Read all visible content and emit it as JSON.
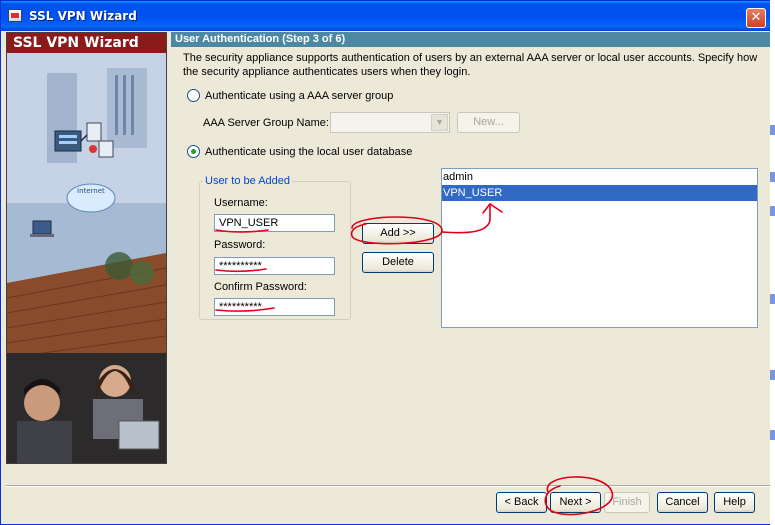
{
  "window": {
    "title": "SSL VPN Wizard",
    "close_glyph": "✕",
    "icon": "app-icon"
  },
  "left_panel": {
    "header": "SSL VPN Wizard",
    "globe_text": "Internet"
  },
  "step": {
    "header": "User Authentication  (Step 3 of 6)",
    "description": "The security appliance supports authentication of users by an external AAA server or local user accounts. Specify how the security appliance authenticates users when they login."
  },
  "auth": {
    "aaa_radio_label": "Authenticate using a AAA server group",
    "aaa_group_label": "AAA Server Group Name:",
    "aaa_group_value": "",
    "new_button": "New...",
    "local_radio_label": "Authenticate using the local user database",
    "selected": "local"
  },
  "user_form": {
    "group_title": "User to be Added",
    "username_label": "Username:",
    "username_value": "VPN_USER",
    "password_label": "Password:",
    "password_value": "**********",
    "confirm_label": "Confirm Password:",
    "confirm_value": "**********"
  },
  "actions": {
    "add_button": "Add >>",
    "delete_button": "Delete"
  },
  "user_list": {
    "items": [
      "admin",
      "VPN_USER"
    ],
    "selected_index": 1
  },
  "footer": {
    "back": "< Back",
    "next": "Next >",
    "finish": "Finish",
    "cancel": "Cancel",
    "help": "Help"
  },
  "colors": {
    "annotation": "#e0001a",
    "header_band": "#4c88a2",
    "brand_red": "#8b1a1a",
    "selection": "#316ac5"
  }
}
